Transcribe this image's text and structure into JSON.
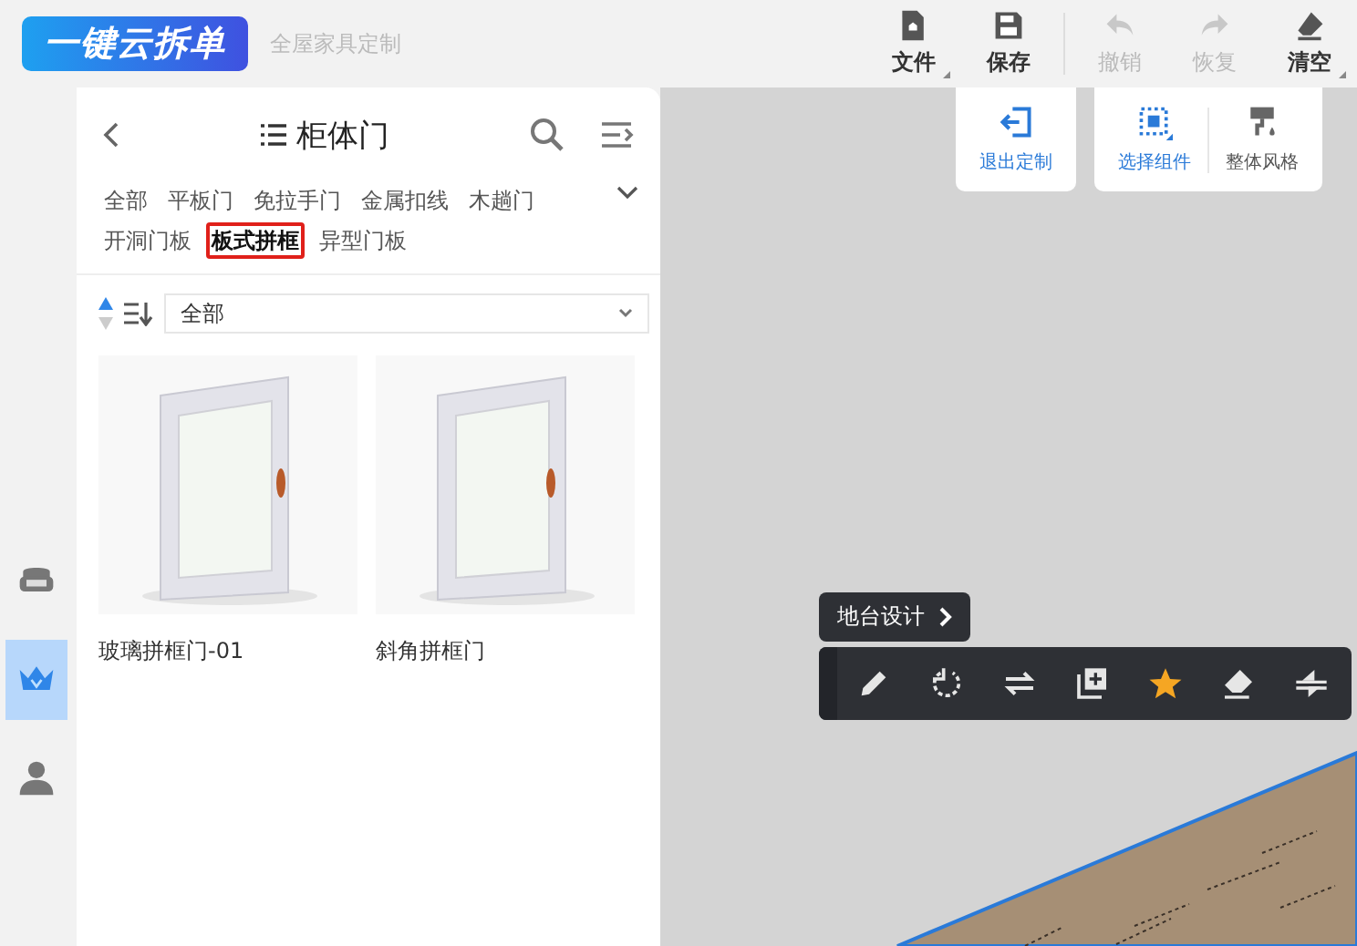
{
  "app": {
    "logo": "一键云拆单",
    "subtitle": "全屋家具定制"
  },
  "toolbar": [
    {
      "label": "文件",
      "kind": "file",
      "disabled": false,
      "has_menu": true
    },
    {
      "label": "保存",
      "kind": "save",
      "disabled": false,
      "has_menu": false
    },
    {
      "label": "撤销",
      "kind": "undo",
      "disabled": true,
      "has_menu": false
    },
    {
      "label": "恢复",
      "kind": "redo",
      "disabled": true,
      "has_menu": false
    },
    {
      "label": "清空",
      "kind": "clear",
      "disabled": false,
      "has_menu": true
    }
  ],
  "sidebar_rail": [
    {
      "kind": "sofa",
      "selected": false
    },
    {
      "kind": "crown",
      "selected": true
    },
    {
      "kind": "user",
      "selected": false
    }
  ],
  "panel": {
    "title": "柜体门",
    "categories": [
      {
        "label": "全部",
        "selected": false
      },
      {
        "label": "平板门",
        "selected": false
      },
      {
        "label": "免拉手门",
        "selected": false
      },
      {
        "label": "金属扣线",
        "selected": false
      },
      {
        "label": "木趟门",
        "selected": false
      },
      {
        "label": "开洞门板",
        "selected": false
      },
      {
        "label": "板式拼框",
        "selected": true
      },
      {
        "label": "异型门板",
        "selected": false
      }
    ],
    "sort": {
      "ascending": true
    },
    "filter": {
      "value": "全部"
    },
    "items": [
      {
        "name": "玻璃拼框门-01"
      },
      {
        "name": "斜角拼框门"
      }
    ]
  },
  "canvas_toolbar": [
    {
      "tools": [
        {
          "label": "退出定制",
          "kind": "exit",
          "active": true
        }
      ]
    },
    {
      "tools": [
        {
          "label": "选择组件",
          "kind": "select",
          "active": true,
          "has_menu": true
        },
        {
          "label": "整体风格",
          "kind": "style",
          "active": false,
          "has_menu": false
        }
      ]
    }
  ],
  "floating": {
    "breadcrumb": "地台设计",
    "tools": [
      {
        "kind": "edit",
        "active": false
      },
      {
        "kind": "rotate",
        "active": false
      },
      {
        "kind": "swap",
        "active": false
      },
      {
        "kind": "duplicate",
        "active": false
      },
      {
        "kind": "favorite",
        "active": true
      },
      {
        "kind": "erase",
        "active": false
      },
      {
        "kind": "flip",
        "active": false
      }
    ]
  }
}
